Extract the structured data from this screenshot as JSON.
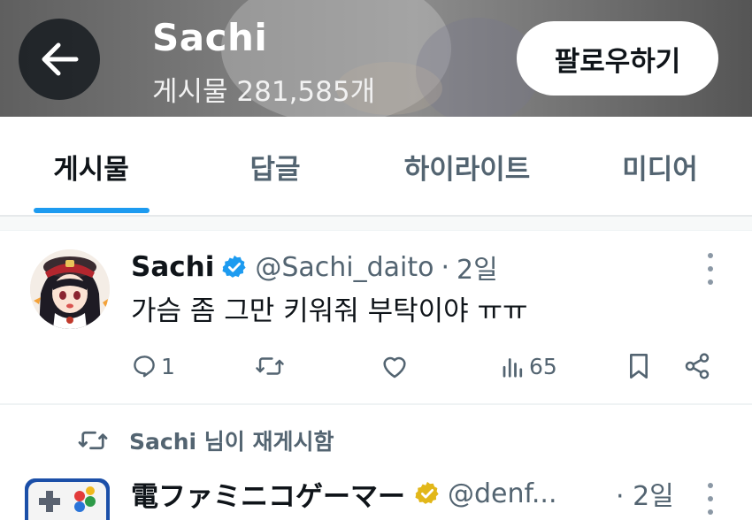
{
  "header": {
    "profile_name": "Sachi",
    "post_count": "게시물 281,585개",
    "follow_label": "팔로우하기"
  },
  "tabs": [
    {
      "label": "게시물",
      "active": true
    },
    {
      "label": "답글",
      "active": false
    },
    {
      "label": "하이라이트",
      "active": false
    },
    {
      "label": "미디어",
      "active": false
    }
  ],
  "post": {
    "author": "Sachi",
    "handle": "@Sachi_daito",
    "separator": "·",
    "time": "2일",
    "text": "가슴 좀 그만 키워줘 부탁이야 ㅠㅠ",
    "verified_color": "#1d9bf0",
    "actions": {
      "reply_count": "1",
      "views_count": "65"
    }
  },
  "repost": {
    "label": "Sachi 님이 재게시함",
    "author": "電ファミニコゲーマー",
    "handle": "@denf...",
    "time": "· 2일",
    "badge_color": "#e2b719"
  },
  "colors": {
    "accent": "#1d9bf0",
    "text_primary": "#0f1419",
    "text_secondary": "#536471"
  }
}
